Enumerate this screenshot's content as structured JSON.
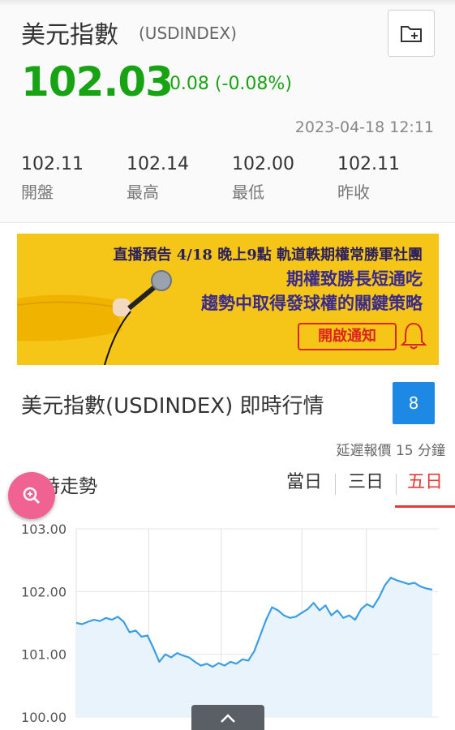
{
  "quote": {
    "name": "美元指數",
    "symbol": "(USDINDEX)",
    "price": "102.03",
    "change": "-0.08 (-0.08%)",
    "timestamp": "2023-04-18 12:11",
    "stats": [
      {
        "value": "102.11",
        "label": "開盤"
      },
      {
        "value": "102.14",
        "label": "最高"
      },
      {
        "value": "102.00",
        "label": "最低"
      },
      {
        "value": "102.11",
        "label": "昨收"
      }
    ],
    "colors": {
      "up_down": "#17a313"
    }
  },
  "banner": {
    "line1": "直播預告 4/18 晚上9點 軌道軼期權常勝軍社團",
    "line2": "期權致勝長短通吃",
    "line3": "趨勢中取得發球權的關鍵策略",
    "notify_label": "開啟通知",
    "icons": [
      "microphone-icon",
      "bell-icon"
    ]
  },
  "section": {
    "title": "美元指數(USDINDEX) 即時行情",
    "badge": "8",
    "delay_note": "延遲報價 15 分鐘"
  },
  "trend": {
    "label": "即時走勢",
    "tabs": [
      "當日",
      "三日",
      "五日"
    ],
    "active_tab": "五日"
  },
  "chart_data": {
    "type": "line",
    "ylim": [
      100.0,
      103.0
    ],
    "y_ticks": [
      "103.00",
      "102.00",
      "101.00",
      "100.00"
    ],
    "grid": true,
    "sessions": 5,
    "series": [
      {
        "values": [
          101.5,
          101.48,
          101.52,
          101.55,
          101.53,
          101.58,
          101.55,
          101.6,
          101.52,
          101.35,
          101.38,
          101.28,
          101.3,
          101.1,
          100.88,
          101.0,
          100.95,
          101.02,
          100.98,
          100.95,
          100.88,
          100.82,
          100.85,
          100.8,
          100.86,
          100.82,
          100.88,
          100.85,
          100.92,
          100.9,
          101.05,
          101.3,
          101.55,
          101.75,
          101.7,
          101.62,
          101.58,
          101.6,
          101.66,
          101.72,
          101.82,
          101.7,
          101.78,
          101.62,
          101.7,
          101.58,
          101.62,
          101.55,
          101.72,
          101.8,
          101.75,
          101.9,
          102.1,
          102.22,
          102.18,
          102.15,
          102.12,
          102.14,
          102.08,
          102.05,
          102.03
        ]
      }
    ],
    "colors": {
      "line": "#3a9ee4",
      "fill": "#e9f3fc"
    }
  }
}
